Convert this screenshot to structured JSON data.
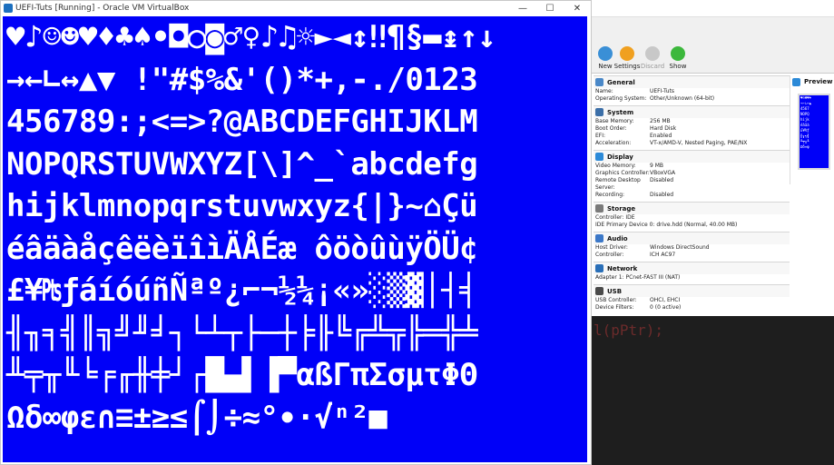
{
  "vm_window": {
    "title": "UEFI-Tuts [Running] - Oracle VM VirtualBox",
    "controls": {
      "minimize": "—",
      "maximize": "☐",
      "close": "✕"
    },
    "screen_lines": [
      "♥♪☺☻♥♦♣♠•◘○◙♂♀♪♫☼►◄↕‼¶§▬↨↑↓",
      "→←∟↔▲▼ !\"#$%&'()*+,-./0123",
      "456789:;<=>?@ABCDEFGHIJKLM",
      "NOPQRSTUVWXYZ[\\]^_`abcdefg",
      "hijklmnopqrstuvwxyz{|}~⌂Çü",
      "éâäàåçêëèïîìÄÅÉæ ôöòûùÿÖÜ¢",
      "£¥₧ƒáíóúñÑªº¿⌐¬½¼¡«»░▒▓│┤╡",
      "╢╖╕╣║╗╝╜╛┐└┴┬├─┼╞╟╚╔╩╦╠═╬╧",
      "╨╤╥╙╘╒╓╫╪┘┌█▄▌▐▀αßΓπΣσµτΦΘ",
      "Ωδ∞φε∩≡±≥≤⌠⌡÷≈°∙·√ⁿ²■"
    ]
  },
  "manager": {
    "toolbar": {
      "new_label": "New",
      "settings_label": "Settings",
      "discard_label": "Discard",
      "show_label": "Show"
    },
    "sections": {
      "general": {
        "title": "General",
        "name_k": "Name:",
        "name_v": "UEFI-Tuts",
        "os_k": "Operating System:",
        "os_v": "Other/Unknown (64-bit)"
      },
      "system": {
        "title": "System",
        "mem_k": "Base Memory:",
        "mem_v": "256 MB",
        "boot_k": "Boot Order:",
        "boot_v": "Hard Disk",
        "efi_k": "EFI:",
        "efi_v": "Enabled",
        "accel_k": "Acceleration:",
        "accel_v": "VT-x/AMD-V, Nested Paging, PAE/NX"
      },
      "display": {
        "title": "Display",
        "vmem_k": "Video Memory:",
        "vmem_v": "9 MB",
        "gc_k": "Graphics Controller:",
        "gc_v": "VBoxVGA",
        "rds_k": "Remote Desktop Server:",
        "rds_v": "Disabled",
        "rec_k": "Recording:",
        "rec_v": "Disabled"
      },
      "storage": {
        "title": "Storage",
        "ctrl_line": "Controller: IDE",
        "dev_line": "IDE Primary Device 0:   drive.hdd (Normal, 40.00 MB)"
      },
      "audio": {
        "title": "Audio",
        "host_k": "Host Driver:",
        "host_v": "Windows DirectSound",
        "ctrl_k": "Controller:",
        "ctrl_v": "ICH AC97"
      },
      "network": {
        "title": "Network",
        "adapter_line": "Adapter 1:   PCnet-FAST III (NAT)"
      },
      "usb": {
        "title": "USB",
        "ctrl_k": "USB Controller:",
        "ctrl_v": "OHCI, EHCI",
        "filters_k": "Device Filters:",
        "filters_v": "0 (0 active)"
      }
    },
    "preview": {
      "title": "Preview",
      "thumb_lines": [
        "♥☺☻♥♦",
        "→←∟↔▲",
        "4567",
        "NOPQ",
        "hijk",
        "éâäà",
        "£¥₧ƒ",
        "╢╖╕╣",
        "╨╤╥╙",
        "Ωδ∞φ"
      ]
    }
  },
  "editor": {
    "code_fragment": "l(pPtr);"
  },
  "colors": {
    "vm_screen_bg": "#0000f8",
    "vm_text": "#ffffff",
    "editor_bg": "#1e1e1e"
  }
}
